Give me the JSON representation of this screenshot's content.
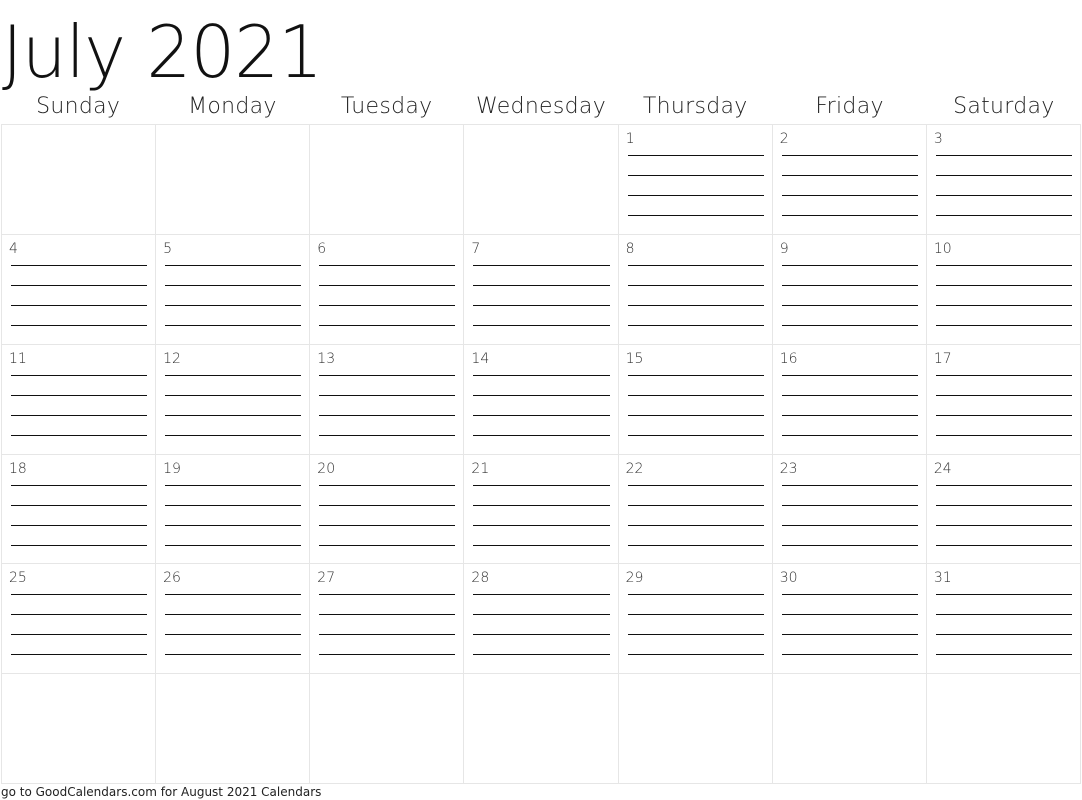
{
  "calendar": {
    "title": "July 2021",
    "month": "July",
    "year": 2021,
    "weekdays": [
      "Sunday",
      "Monday",
      "Tuesday",
      "Wednesday",
      "Thursday",
      "Friday",
      "Saturday"
    ],
    "weeks": [
      [
        "",
        "",
        "",
        "",
        "1",
        "2",
        "3"
      ],
      [
        "4",
        "5",
        "6",
        "7",
        "8",
        "9",
        "10"
      ],
      [
        "11",
        "12",
        "13",
        "14",
        "15",
        "16",
        "17"
      ],
      [
        "18",
        "19",
        "20",
        "21",
        "22",
        "23",
        "24"
      ],
      [
        "25",
        "26",
        "27",
        "28",
        "29",
        "30",
        "31"
      ],
      [
        "",
        "",
        "",
        "",
        "",
        "",
        ""
      ]
    ],
    "note_lines_per_day": 4
  },
  "footer": {
    "text": "go to GoodCalendars.com for August 2021 Calendars"
  }
}
